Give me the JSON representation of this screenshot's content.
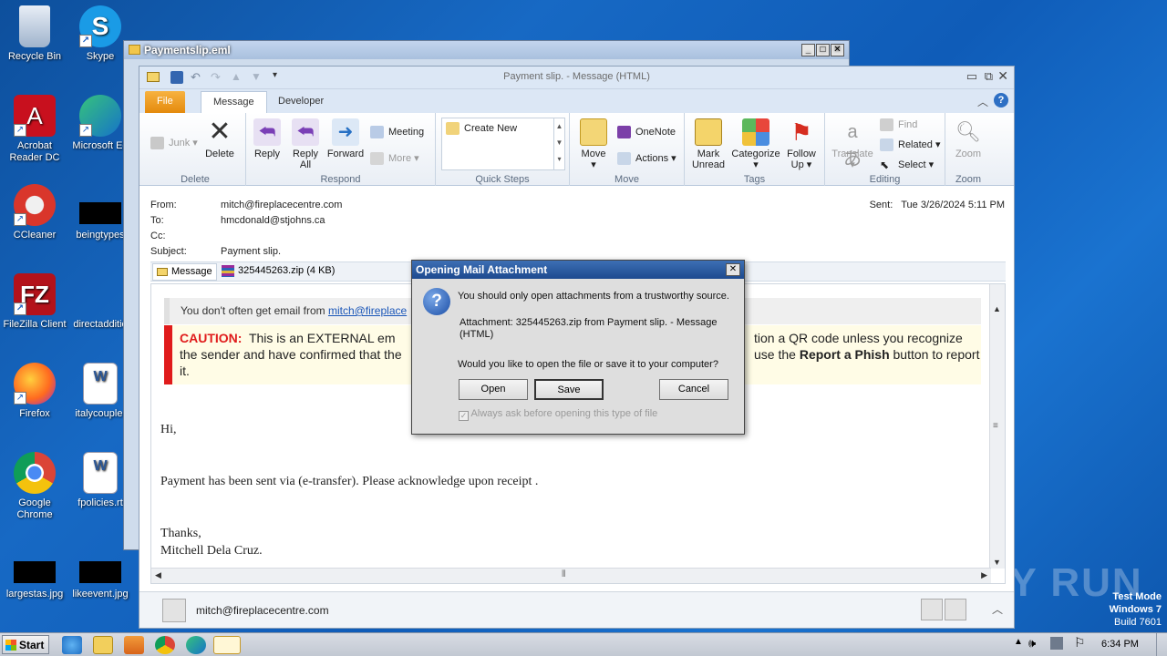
{
  "desktop": {
    "icons": [
      {
        "label": "Recycle Bin"
      },
      {
        "label": "Skype"
      },
      {
        "label": "Acrobat Reader DC"
      },
      {
        "label": "Microsoft Ed"
      },
      {
        "label": "CCleaner"
      },
      {
        "label": "beingtypes"
      },
      {
        "label": "FileZilla Client"
      },
      {
        "label": "directadditio"
      },
      {
        "label": "Firefox"
      },
      {
        "label": "italycouple."
      },
      {
        "label": "Google Chrome"
      },
      {
        "label": "fpolicies.rt"
      },
      {
        "label": "largestas.jpg"
      },
      {
        "label": "likeevent.jpg"
      }
    ],
    "watermark": "ANY RUN",
    "test_mode": {
      "line1": "Test Mode",
      "line2": "Windows 7",
      "line3": "Build 7601"
    }
  },
  "back_window": {
    "title": "Paymentslip.eml"
  },
  "outlook": {
    "window_title": "Payment slip. - Message (HTML)",
    "tabs": {
      "file": "File",
      "message": "Message",
      "developer": "Developer"
    },
    "ribbon": {
      "delete_group": {
        "label": "Delete",
        "junk": "Junk",
        "delete": "Delete"
      },
      "respond_group": {
        "label": "Respond",
        "reply": "Reply",
        "reply_all": "Reply All",
        "forward": "Forward",
        "meeting": "Meeting",
        "more": "More"
      },
      "quicksteps_group": {
        "label": "Quick Steps",
        "create_new": "Create New"
      },
      "move_group": {
        "label": "Move",
        "move": "Move",
        "onenote": "OneNote",
        "actions": "Actions"
      },
      "tags_group": {
        "label": "Tags",
        "mark_unread": "Mark Unread",
        "categorize": "Categorize",
        "follow_up": "Follow Up"
      },
      "editing_group": {
        "label": "Editing",
        "translate": "Translate",
        "find": "Find",
        "related": "Related",
        "select": "Select"
      },
      "zoom_group": {
        "label": "Zoom",
        "zoom": "Zoom"
      }
    },
    "header": {
      "from_label": "From:",
      "from": "mitch@fireplacecentre.com",
      "to_label": "To:",
      "to": "hmcdonald@stjohns.ca",
      "cc_label": "Cc:",
      "cc": "",
      "subject_label": "Subject:",
      "subject": "Payment slip.",
      "sent_label": "Sent:",
      "sent": "Tue 3/26/2024 5:11 PM"
    },
    "attachments": {
      "message_tab": "Message",
      "file": "325445263.zip (4 KB)"
    },
    "body": {
      "notice_prefix": "You don't often get email from ",
      "notice_link": "mitch@fireplace",
      "caution_label": "CAUTION:",
      "caution_line1": "This is an EXTERNAL em",
      "caution_line1_right": "tion a QR code unless you recognize",
      "caution_line2": "the sender and have confirmed that the",
      "caution_line2_right_pre": "use the ",
      "caution_line2_bold": "Report a Phish",
      "caution_line2_post": " button to report",
      "caution_line3": "it.",
      "greeting": "Hi,",
      "paragraph": "Payment has been sent via (e-transfer). Please acknowledge upon receipt .",
      "signoff": "Thanks,",
      "signature": "Mitchell Dela Cruz."
    },
    "footer": {
      "sender": "mitch@fireplacecentre.com"
    }
  },
  "dialog": {
    "title": "Opening Mail Attachment",
    "warning": "You should only open attachments from a trustworthy source.",
    "attachment_line1": "Attachment: 325445263.zip from Payment slip. - Message",
    "attachment_line2": "(HTML)",
    "question": "Would you like to open the file or save it to your computer?",
    "open": "Open",
    "save": "Save",
    "cancel": "Cancel",
    "checkbox_label": "Always ask before opening this type of file"
  },
  "taskbar": {
    "start": "Start",
    "time": "6:34 PM"
  }
}
